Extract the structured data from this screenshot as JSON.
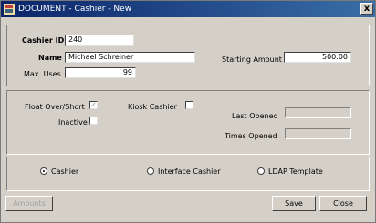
{
  "window": {
    "title": "DOCUMENT - Cashier - New",
    "close": "x"
  },
  "form": {
    "cashier_id": {
      "label": "Cashier ID",
      "value": "240"
    },
    "name": {
      "label": "Name",
      "value": "Michael Schreiner"
    },
    "starting_amount": {
      "label": "Starting Amount",
      "value": "500.00"
    },
    "max_uses": {
      "label": "Max. Uses",
      "value": "99"
    }
  },
  "options": {
    "float_over_short": {
      "label": "Float Over/Short",
      "checked": true
    },
    "kiosk_cashier": {
      "label": "Kiosk Cashier",
      "checked": false
    },
    "inactive": {
      "label": "Inactive",
      "checked": false
    },
    "last_opened": {
      "label": "Last Opened",
      "value": ""
    },
    "times_opened": {
      "label": "Times Opened",
      "value": ""
    }
  },
  "type": {
    "selected": "Cashier",
    "options": [
      "Cashier",
      "Interface Cashier",
      "LDAP Template"
    ]
  },
  "buttons": {
    "amounts": "Amounts",
    "save": "Save",
    "close": "Close"
  },
  "check_mark": "✓"
}
